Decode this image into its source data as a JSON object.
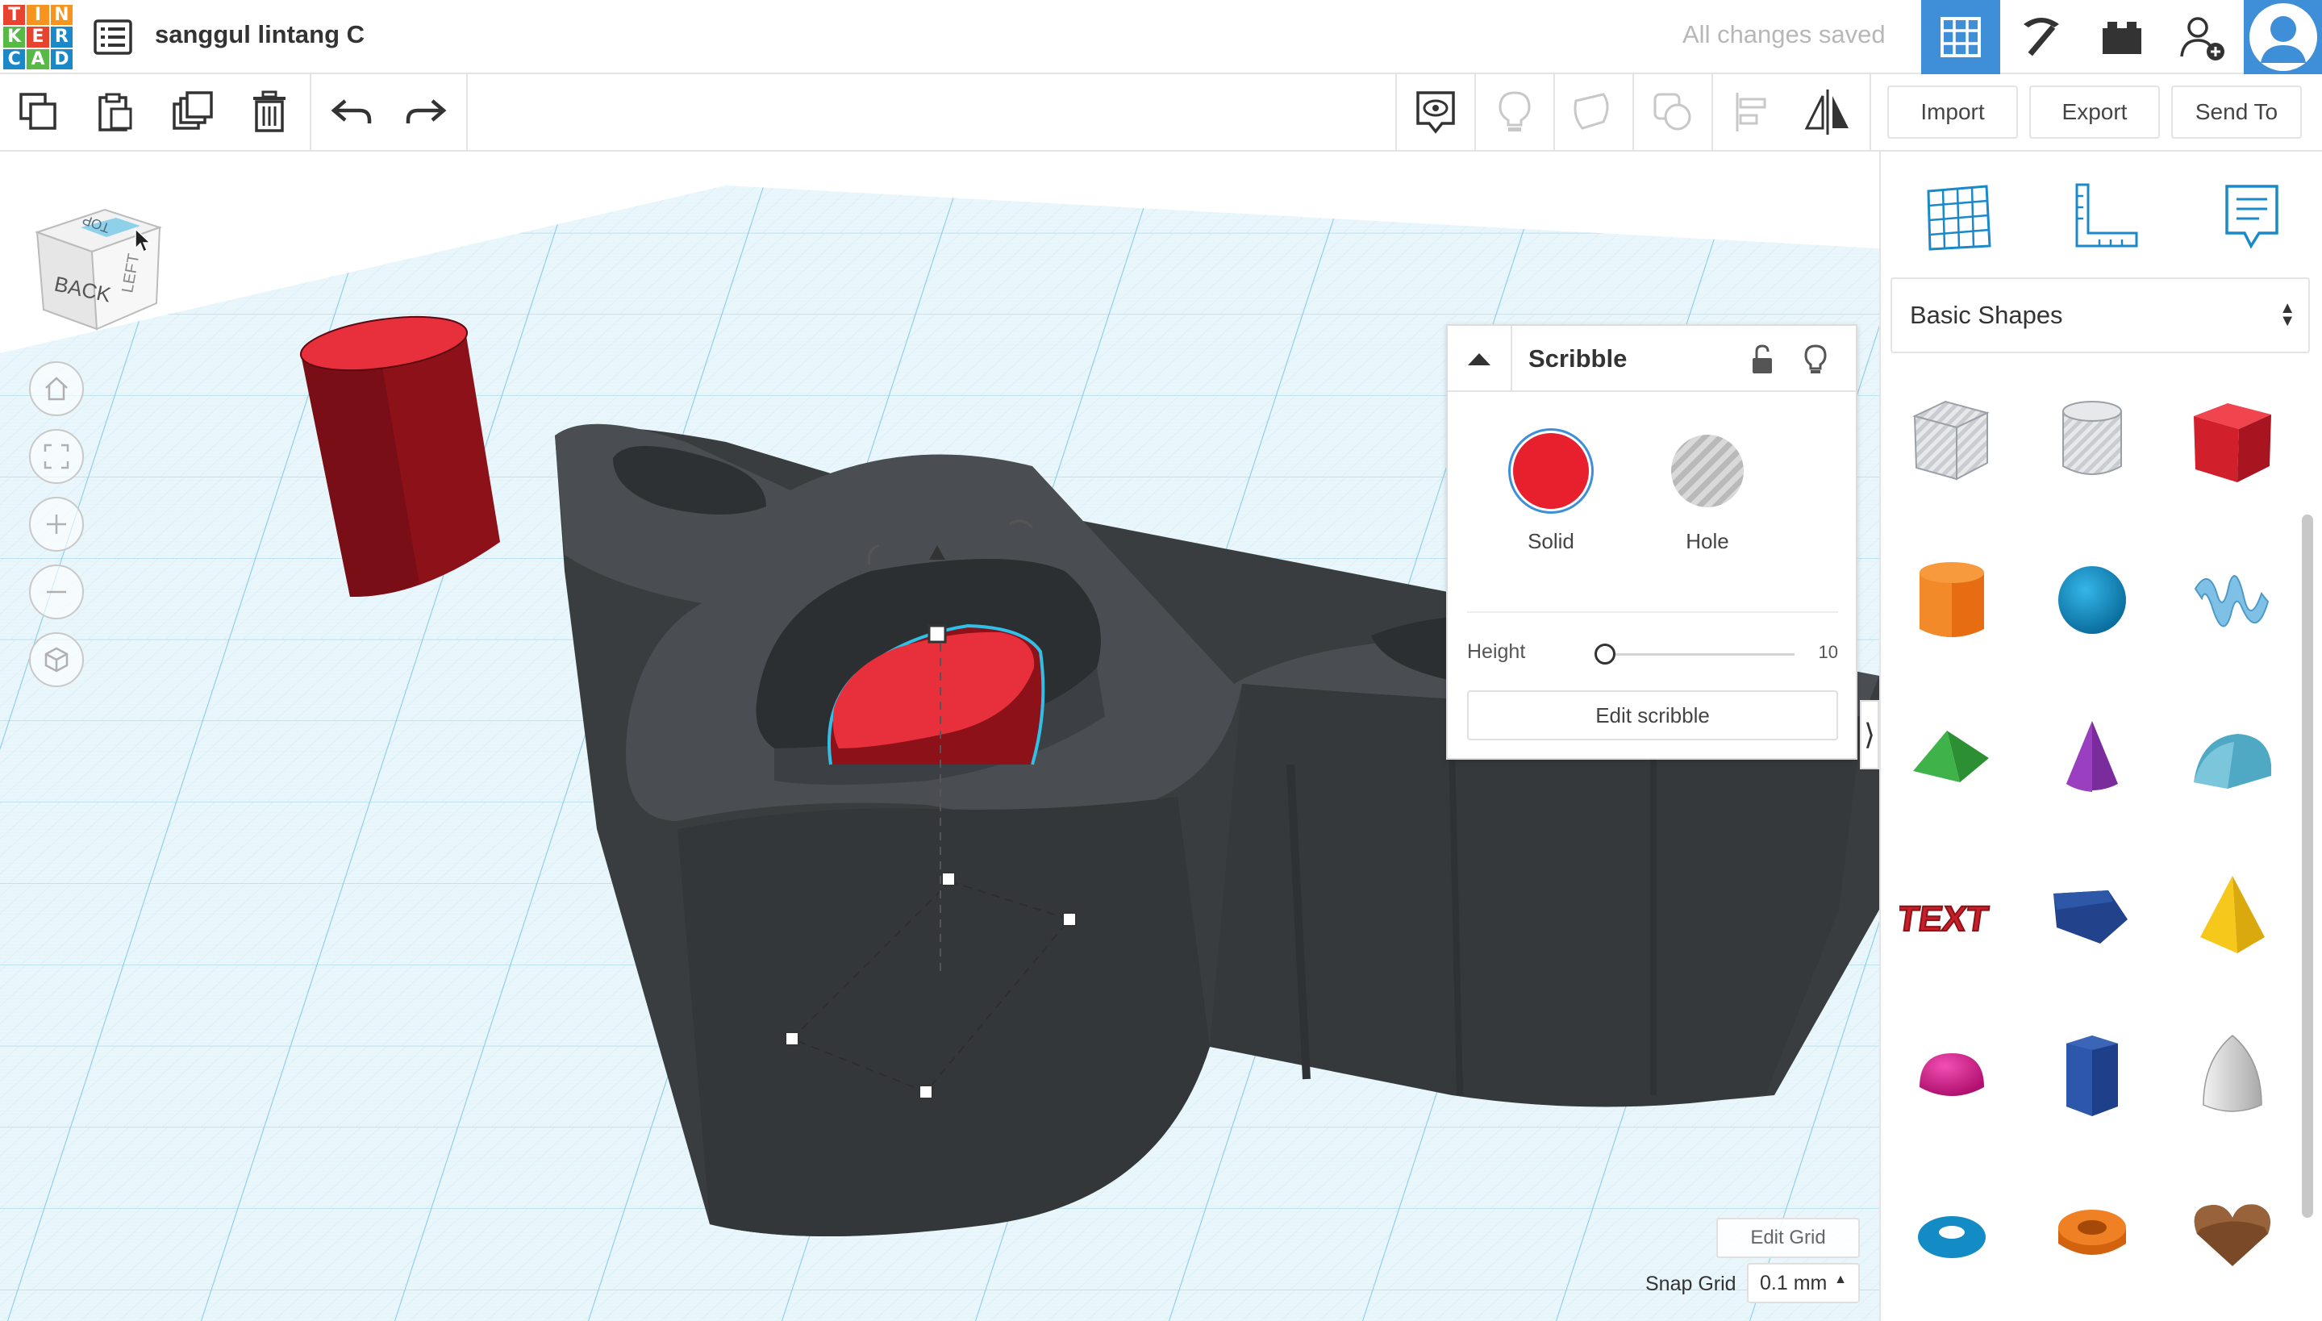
{
  "app": {
    "logo_letters": [
      "T",
      "I",
      "N",
      "K",
      "E",
      "R",
      "C",
      "A",
      "D"
    ],
    "logo_colors": [
      "#e8432e",
      "#f7941d",
      "#f7941d",
      "#59b947",
      "#e8432e",
      "#1a88c9",
      "#1a88c9",
      "#59b947",
      "#1a88c9"
    ],
    "design_title": "sanggul lintang C",
    "save_status": "All changes saved",
    "accent_color": "#3f8fd8"
  },
  "toolbar": {
    "import_label": "Import",
    "export_label": "Export",
    "send_to_label": "Send To"
  },
  "view_cube": {
    "front_label": "BACK",
    "top_label": "TOP",
    "side_label": "LEFT"
  },
  "inspector": {
    "title": "Scribble",
    "solid_label": "Solid",
    "hole_label": "Hole",
    "solid_color": "#e8202e",
    "height_label": "Height",
    "height_value": "10",
    "edit_button_label": "Edit scribble"
  },
  "workplane": {
    "edit_grid_label": "Edit Grid",
    "snap_grid_label": "Snap Grid",
    "snap_grid_value": "0.1 mm",
    "grid_color": "#bfe3f1"
  },
  "shapes_panel": {
    "category": "Basic Shapes",
    "shapes": [
      "box-hole",
      "cylinder-hole",
      "box",
      "cylinder",
      "sphere",
      "scribble",
      "roof",
      "cone",
      "round-roof",
      "text",
      "wedge-polygon",
      "pyramid",
      "half-sphere",
      "hexagonal-prism",
      "paraboloid",
      "torus",
      "tube",
      "heart"
    ],
    "text_shape_label": "TEXT"
  }
}
